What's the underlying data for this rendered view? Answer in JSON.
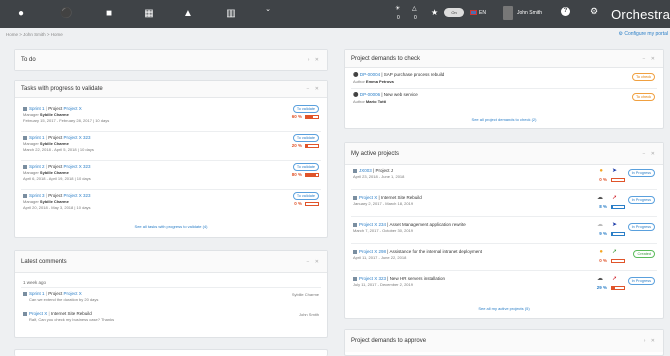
{
  "brand": "Orchestra",
  "topbar": {
    "notif_count_1": "0",
    "notif_count_2": "0",
    "toggle": "On",
    "language": "EN",
    "user": "John Smith"
  },
  "breadcrumb": "Home  >  John Smith  >  Home",
  "configure_link": "Configure my portal",
  "todo": {
    "title": "To do"
  },
  "tasks": {
    "title": "Tasks with progress to validate",
    "items": [
      {
        "sprint": "Sprint 1",
        "project_label": "Project",
        "project": "Project X",
        "manager_label": "Manager",
        "manager": "Sybille Charme",
        "dates": "February 15, 2017 - February 28, 2017",
        "days": "10 days",
        "status": "To validate",
        "pct": "60 %",
        "progress": 0.6
      },
      {
        "sprint": "Sprint 1",
        "project_label": "Project",
        "project": "Project X 323",
        "manager_label": "Manager",
        "manager": "Sybille Charme",
        "dates": "March 22, 2018 - April 5, 2018",
        "days": "10 days",
        "status": "To validate",
        "pct": "20 %",
        "progress": 0.2
      },
      {
        "sprint": "Sprint 2",
        "project_label": "Project",
        "project": "Project X 323",
        "manager_label": "Manager",
        "manager": "Sybille Charme",
        "dates": "April 6, 2018 - April 19, 2018",
        "days": "10 days",
        "status": "To validate",
        "pct": "80 %",
        "progress": 0.8
      },
      {
        "sprint": "Sprint 3",
        "project_label": "Project",
        "project": "Project X 323",
        "manager_label": "Manager",
        "manager": "Sybille Charme",
        "dates": "April 20, 2018 - May 3, 2018",
        "days": "10 days",
        "status": "To validate",
        "pct": "0 %",
        "progress": 0.0
      }
    ],
    "see_all": "See all tasks with progress to validate (4)"
  },
  "comments": {
    "title": "Latest comments",
    "group": "1 week ago",
    "items": [
      {
        "sprint": "Sprint 1",
        "project_label": "Project",
        "project": "Project X",
        "text": "Can we extend the duration by 20 days",
        "author": "Sybille Charme"
      },
      {
        "project": "Project X",
        "sep": "|",
        "subject": "Internet Site Rebuild",
        "text": "Ralf, Can you check my business case? Thanks",
        "author": "John Smith"
      }
    ]
  },
  "demands_check": {
    "title": "Project demands to check",
    "items": [
      {
        "id": "DP-00004",
        "name": "SAP purchase process rebuild",
        "author_label": "Author",
        "author": "Emma Petrova",
        "status": "To check"
      },
      {
        "id": "DP-00006",
        "name": "New web service",
        "author_label": "Author",
        "author": "Mario Totti",
        "status": "To check"
      }
    ],
    "see_all": "See all project demands to check (2)"
  },
  "active": {
    "title": "My active projects",
    "items": [
      {
        "code": "JX003",
        "name": "Project J",
        "dates": "April 23, 2018 - June 1, 2018",
        "status": "In Progress",
        "pct": "0 %",
        "progress": 0.0,
        "bar": "red",
        "weather": "sun",
        "trend": "arrow-right"
      },
      {
        "code": "Project X",
        "name": "Internet Site Rebuild",
        "dates": "January 2, 2017 - March 18, 2019",
        "status": "In Progress",
        "pct": "8 %",
        "progress": 0.08,
        "bar": "blue",
        "weather": "storm",
        "trend": "arrow-up-right"
      },
      {
        "code": "Project X 234",
        "name": "Asset Management application rewrite",
        "dates": "March 7, 2017 - October 30, 2019",
        "status": "In Progress",
        "pct": "9 %",
        "progress": 0.09,
        "bar": "blue",
        "weather": "cloud",
        "trend": "arrow-right"
      },
      {
        "code": "Project X 298",
        "name": "Assistance for the internal intranet deployment",
        "dates": "April 11, 2017 - June 22, 2018",
        "status": "Created",
        "pct": "0 %",
        "progress": 0.0,
        "bar": "red",
        "weather": "sun",
        "trend": "arrow-down"
      },
      {
        "code": "Project X 323",
        "name": "New HR servers installation",
        "dates": "July 11, 2017 - December 2, 2019",
        "status": "In Progress",
        "pct": "29 %",
        "progress": 0.29,
        "bar": "red",
        "weather": "storm",
        "trend": "arrow-up-right"
      }
    ],
    "see_all": "See all my active projects (5)"
  },
  "approve": {
    "title": "Project demands to approve"
  },
  "colors": {
    "topbar": "#3f4347",
    "link": "#2a7ec7",
    "progress_red": "#e0542a",
    "status_blue": "#2a7ec7",
    "status_orange": "#f0a040",
    "status_green": "#5bbb5b"
  }
}
